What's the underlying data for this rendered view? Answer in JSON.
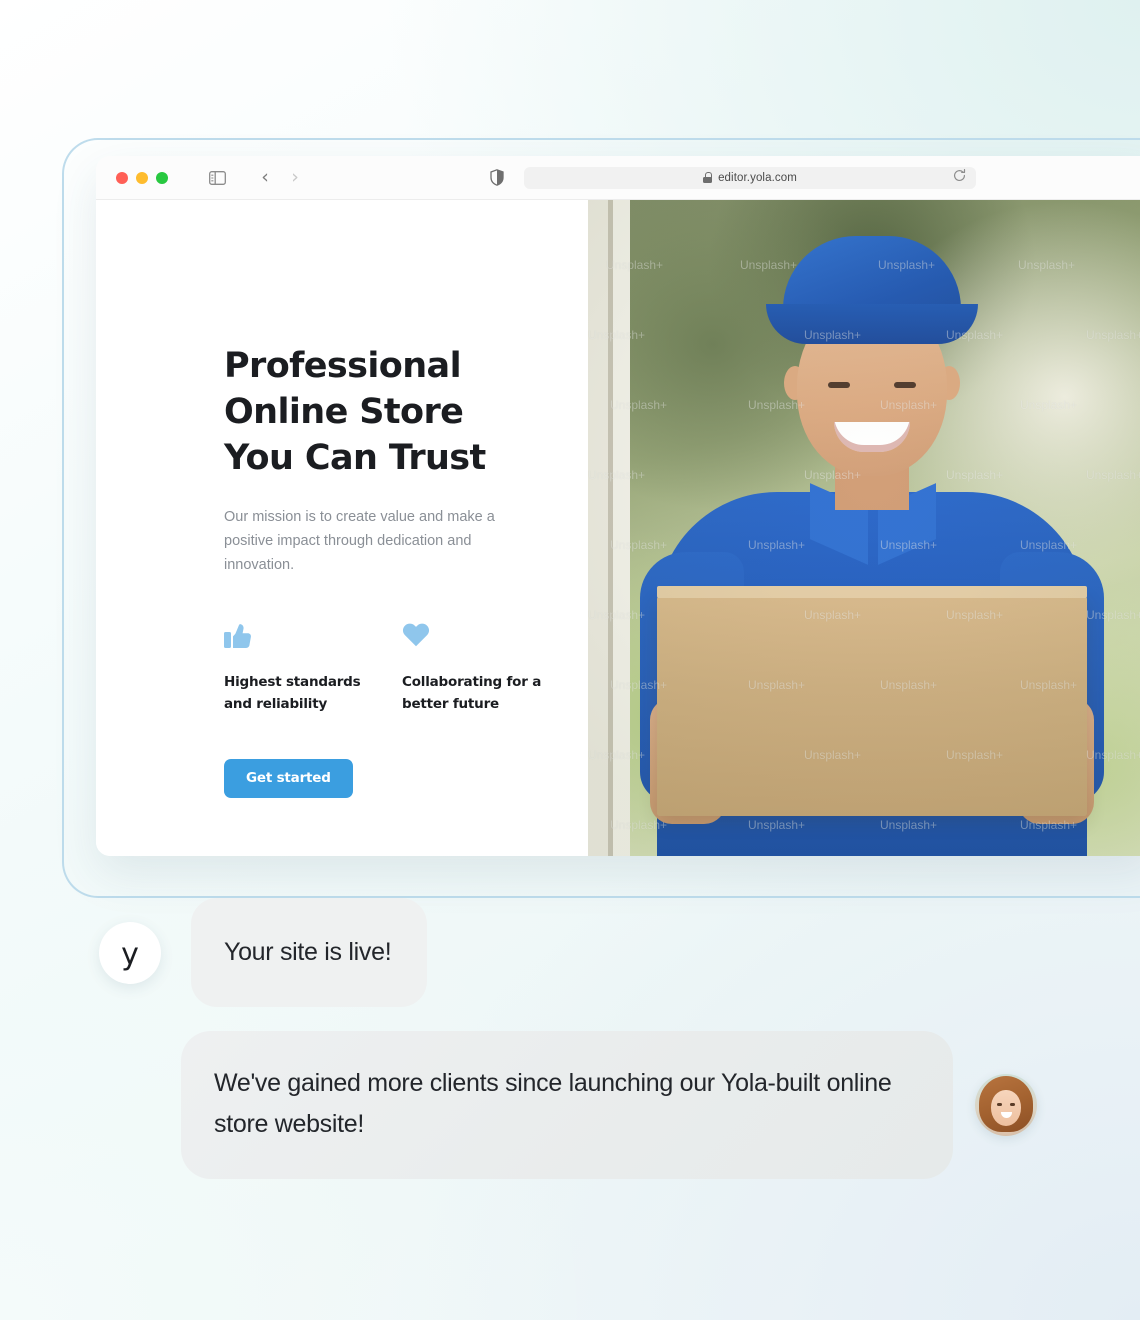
{
  "browser": {
    "traffic_lights": [
      "close",
      "minimize",
      "maximize"
    ],
    "sidebar_icon": "sidebar-toggle-icon",
    "back_icon": "chevron-left-icon",
    "forward_icon": "chevron-right-icon",
    "shield_icon": "shield-icon",
    "lock_icon": "lock-icon",
    "url": "editor.yola.com",
    "reload_icon": "reload-icon"
  },
  "site": {
    "hero_title": "Professional Online Store You Can Trust",
    "hero_subtitle": "Our mission is to create value and make a positive impact through dedication and innovation.",
    "features": [
      {
        "icon": "thumbs-up-icon",
        "label": "Highest standards and reliability"
      },
      {
        "icon": "heart-icon",
        "label": "Collaborating for a better future"
      }
    ],
    "cta_label": "Get started",
    "hero_image": {
      "alt": "Smiling delivery man in blue cap and blue polo shirt holding a large cardboard box",
      "watermark": "Unsplash+"
    }
  },
  "chat": {
    "brand_initial": "y",
    "messages": [
      {
        "from": "yola",
        "text": "Your site is live!"
      },
      {
        "from": "customer",
        "text": "We've gained more clients since launching our Yola-built online store website!"
      }
    ],
    "customer_avatar": "smiling-woman-avatar"
  },
  "colors": {
    "accent_blue": "#3b9ee0",
    "feature_icon_blue": "#8fc6ec",
    "bubble_gray": "#eff1f1",
    "frame_border": "#bedcec",
    "heading": "#1b1d21",
    "body_text": "#8a8f96"
  }
}
